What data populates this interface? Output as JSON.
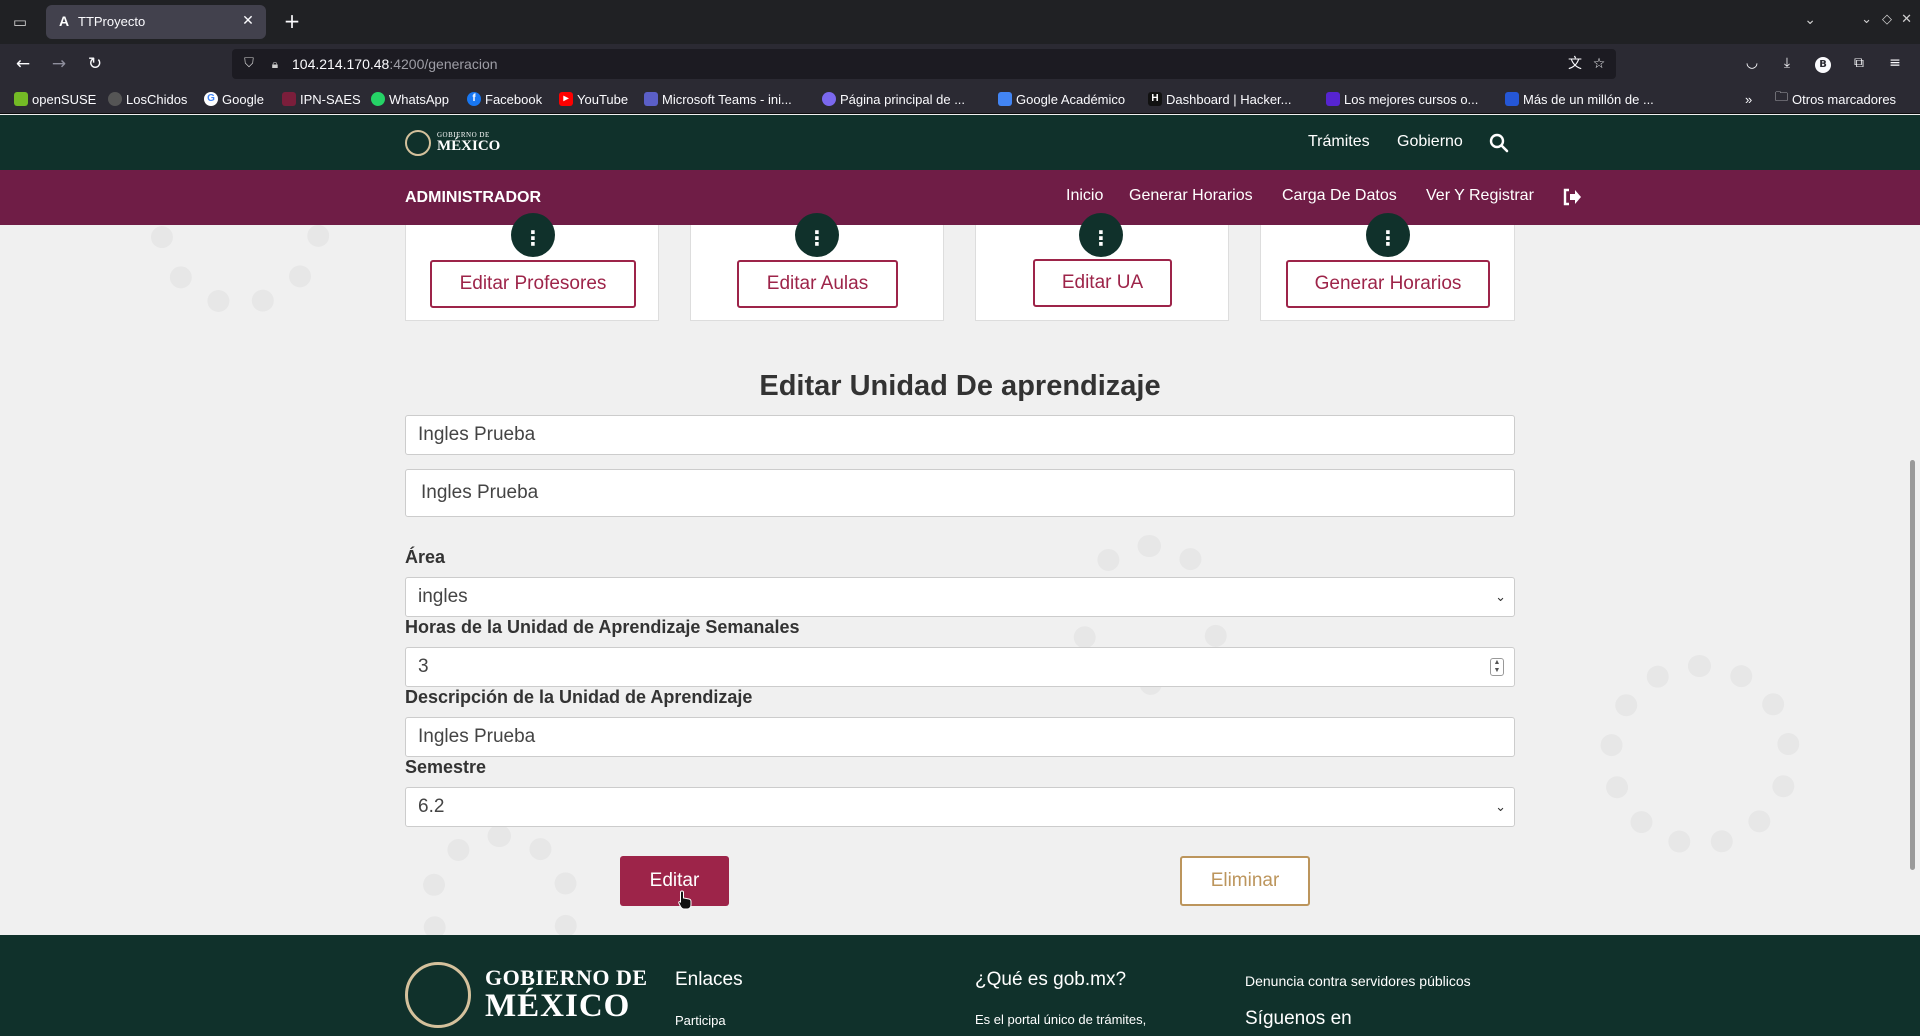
{
  "browser": {
    "tab_title": "TTProyecto",
    "tab_favicon": "A",
    "url_host": "104.214.170.48",
    "url_path": ":4200/generacion",
    "bookmarks": [
      {
        "label": "openSUSE",
        "color": "#73ba25"
      },
      {
        "label": "LosChidos",
        "color": "#555555"
      },
      {
        "label": "Google",
        "color": "#4285f4"
      },
      {
        "label": "IPN-SAES",
        "color": "#7b1e3b"
      },
      {
        "label": "WhatsApp",
        "color": "#25d366"
      },
      {
        "label": "Facebook",
        "color": "#1877f2"
      },
      {
        "label": "YouTube",
        "color": "#ff0000"
      },
      {
        "label": "Microsoft Teams - ini...",
        "color": "#5b5fc7"
      },
      {
        "label": "Página principal de ...",
        "color": "#7b68ee"
      },
      {
        "label": "Google Académico",
        "color": "#4285f4"
      },
      {
        "label": "Dashboard | Hacker...",
        "color": "#111111"
      },
      {
        "label": "Los mejores cursos o...",
        "color": "#5624d0"
      },
      {
        "label": "Más de un millón de ...",
        "color": "#2557d6"
      }
    ],
    "other_bookmarks": "Otros marcadores"
  },
  "gob_header": {
    "logo_small": "GOBIERNO DE",
    "logo_big": "MÉXICO",
    "links": [
      "Trámites",
      "Gobierno"
    ]
  },
  "admin_bar": {
    "title": "ADMINISTRADOR",
    "links": [
      "Inicio",
      "Generar Horarios",
      "Carga De Datos",
      "Ver Y Registrar"
    ]
  },
  "cards": [
    {
      "button": "Editar Profesores"
    },
    {
      "button": "Editar Aulas"
    },
    {
      "button": "Editar UA"
    },
    {
      "button": "Generar Horarios"
    }
  ],
  "form": {
    "title": "Editar Unidad De aprendizaje",
    "field1_value": "Ingles Prueba",
    "field2_value": "Ingles Prueba",
    "area_label": "Área",
    "area_value": "ingles",
    "hours_label": "Horas de la Unidad de Aprendizaje Semanales",
    "hours_value": "3",
    "desc_label": "Descripción de la Unidad de Aprendizaje",
    "desc_value": "Ingles Prueba",
    "semester_label": "Semestre",
    "semester_value": "6.2",
    "edit_button": "Editar",
    "delete_button": "Eliminar"
  },
  "footer": {
    "logo_line1": "GOBIERNO DE",
    "logo_line2": "MÉXICO",
    "enlaces": "Enlaces",
    "participa": "Participa",
    "que_es": "¿Qué es gob.mx?",
    "que_es_desc": "Es el portal único de trámites,",
    "denuncia": "Denuncia contra servidores públicos",
    "siguenos": "Síguenos en"
  },
  "colors": {
    "gob_green": "#10312b",
    "admin_bar": "#6f1d46",
    "guinda": "#9d2449",
    "dorado": "#bc955c"
  }
}
